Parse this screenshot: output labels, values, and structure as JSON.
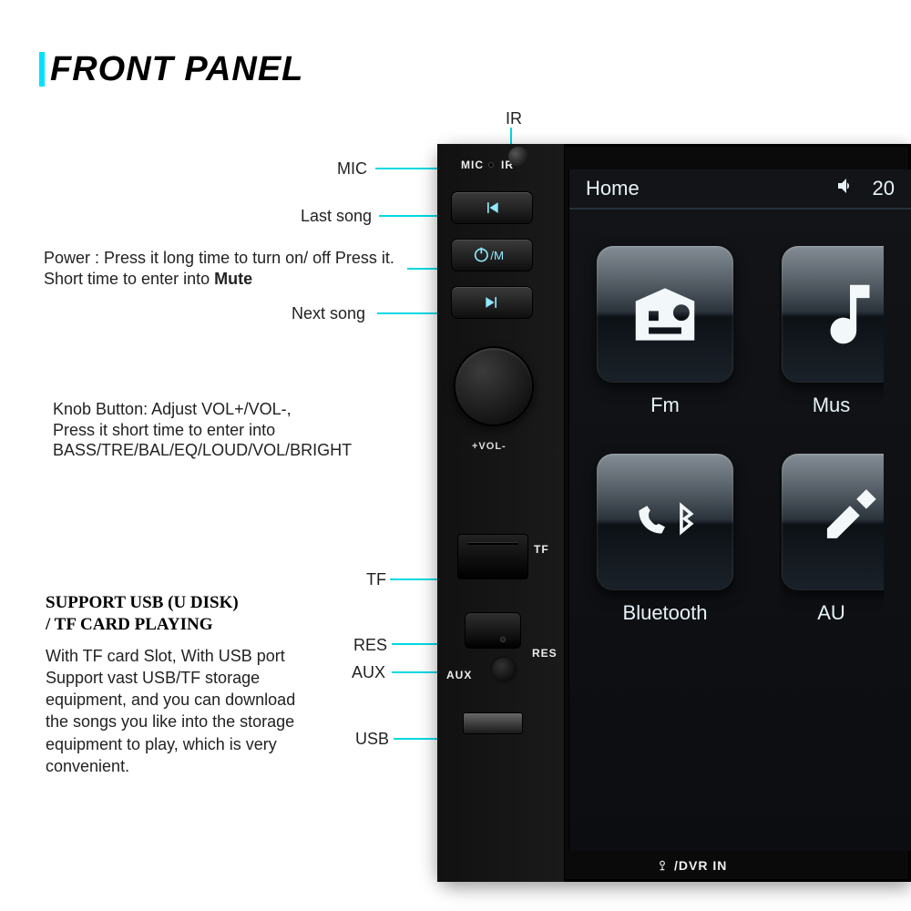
{
  "title": "FRONT PANEL",
  "top_label": "IR",
  "callouts": {
    "mic": "MIC",
    "last_song": "Last song",
    "power_line1": "Power : Press it long time to turn on/ off Press it.",
    "power_line2_a": "Short time to enter into ",
    "power_line2_b": "Mute",
    "next_song": "Next song",
    "knob_line1": "Knob Button: Adjust VOL+/VOL-,",
    "knob_line2": "Press it short time to enter into",
    "knob_line3": "BASS/TRE/BAL/EQ/LOUD/VOL/BRIGHT",
    "tf": "TF",
    "res": "RES",
    "aux": "AUX",
    "usb": "USB"
  },
  "support": {
    "head_line1": "SUPPORT USB (U DISK)",
    "head_line2": "/ TF CARD PLAYING",
    "body": "With TF card Slot, With USB port Support vast USB/TF storage equipment, and you can download the songs you like into the storage equipment to play, which is very convenient."
  },
  "device": {
    "mic": "MIC",
    "ir": "IR",
    "vol": "+VOL-",
    "tf": "TF",
    "res": "RES",
    "aux": "AUX",
    "dvr": "/DVR IN"
  },
  "screen": {
    "home": "Home",
    "volume": "20",
    "tiles": {
      "fm": "Fm",
      "music": "Mus",
      "bluetooth": "Bluetooth",
      "aux": "AU"
    }
  }
}
